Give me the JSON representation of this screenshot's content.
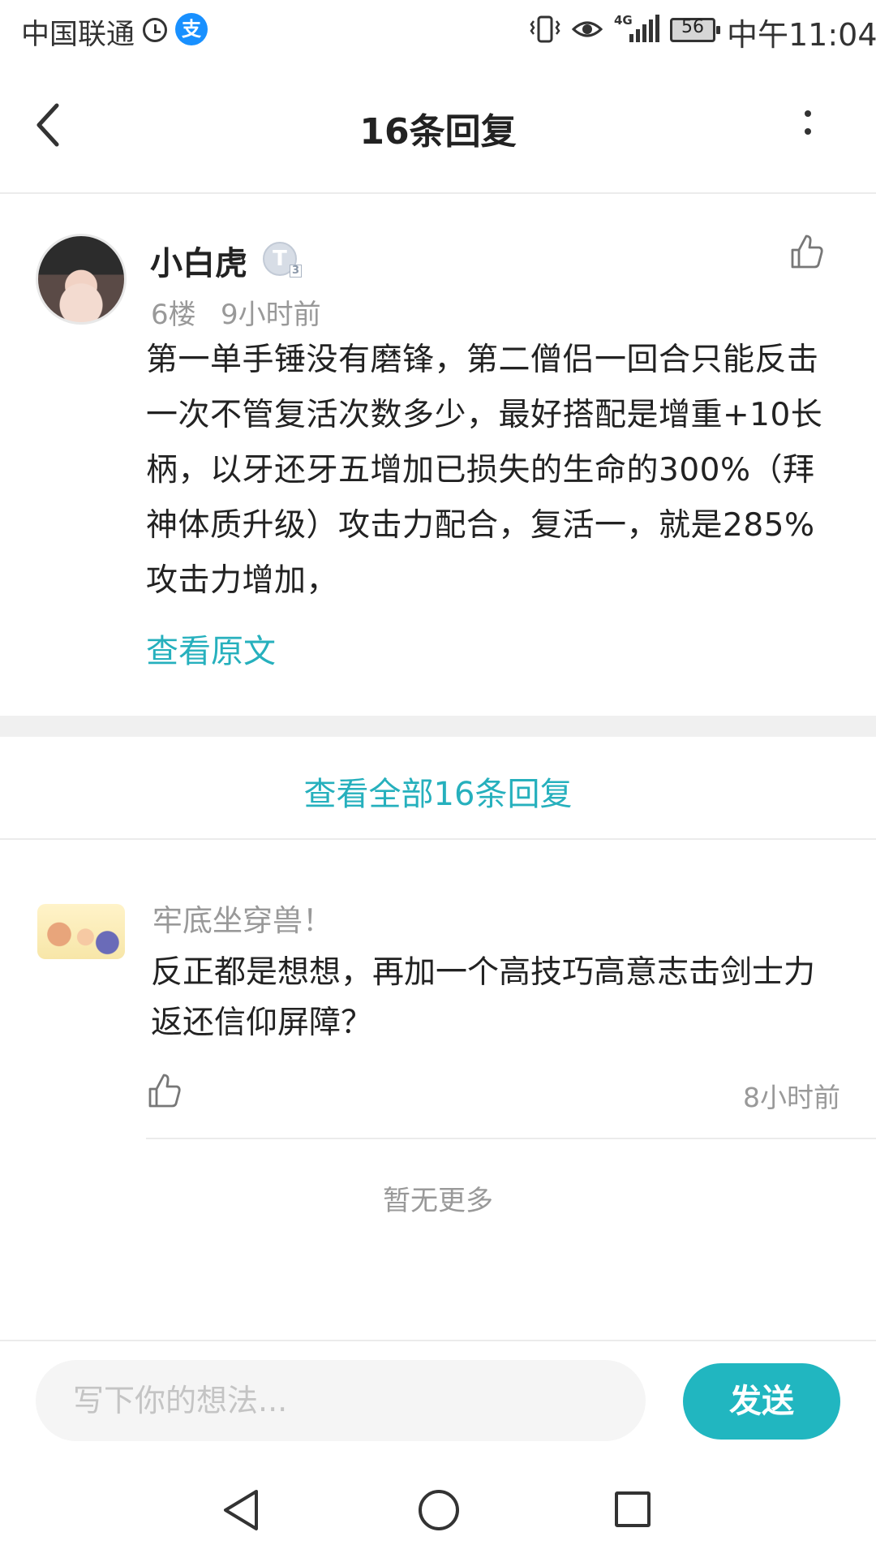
{
  "status_bar": {
    "carrier": "中国联通",
    "alipay_glyph": "支",
    "network": "4G",
    "battery": "56",
    "time": "中午11:04"
  },
  "header": {
    "title": "16条回复"
  },
  "post": {
    "author": "小白虎",
    "level_badge": "T",
    "level_sub": "3",
    "floor": "6楼",
    "time": "9小时前",
    "content": "第一单手锤没有磨锋，第二僧侣一回合只能反击一次不管复活次数多少，最好搭配是增重+10长柄，以牙还牙五增加已损失的生命的300%（拜神体质升级）攻击力配合，复活一，就是285%攻击力增加，",
    "view_original": "查看原文"
  },
  "view_all": "查看全部16条回复",
  "reply": {
    "author": "牢底坐穿兽！",
    "content": "反正都是想想，再加一个高技巧高意志击剑士力返还信仰屏障？",
    "time": "8小时前"
  },
  "no_more": "暂无更多",
  "composer": {
    "placeholder": "写下你的想法...",
    "send_label": "发送"
  },
  "colors": {
    "accent": "#26b0bd",
    "send_button": "#21b6c0"
  }
}
